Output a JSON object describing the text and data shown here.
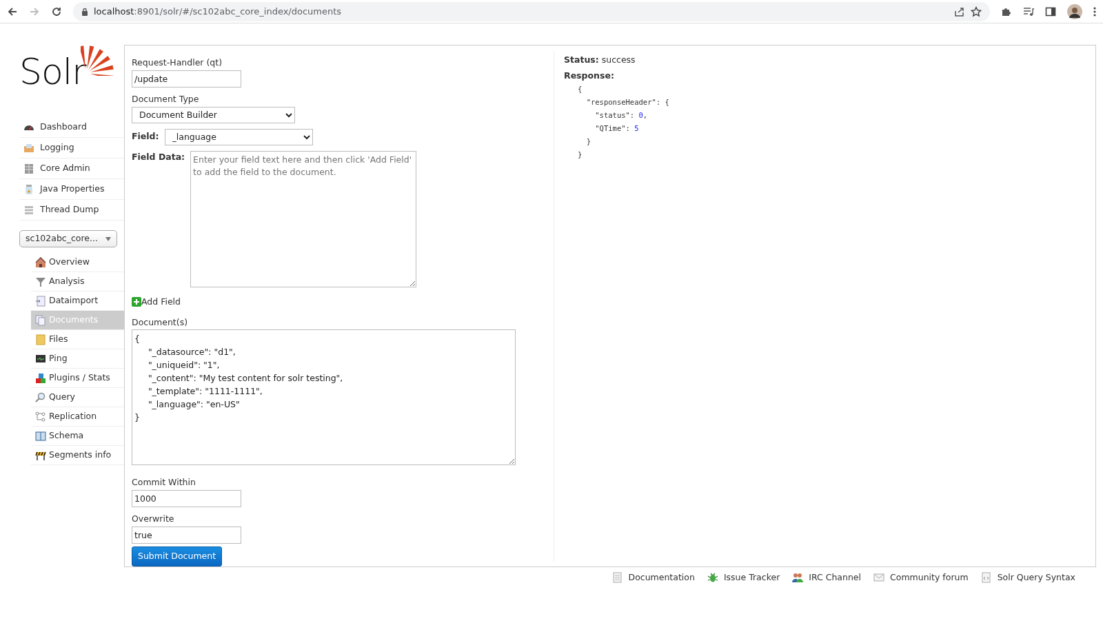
{
  "browser": {
    "url_host": "localhost",
    "url_rest": ":8901/solr/#/sc102abc_core_index/documents",
    "forward_disabled": true
  },
  "logo": {
    "text": "Solr"
  },
  "main_nav": [
    {
      "label": "Dashboard"
    },
    {
      "label": "Logging"
    },
    {
      "label": "Core Admin"
    },
    {
      "label": "Java Properties"
    },
    {
      "label": "Thread Dump"
    }
  ],
  "core_selector": {
    "value": "sc102abc_core..."
  },
  "core_nav": [
    {
      "label": "Overview",
      "selected": false
    },
    {
      "label": "Analysis",
      "selected": false
    },
    {
      "label": "Dataimport",
      "selected": false
    },
    {
      "label": "Documents",
      "selected": true
    },
    {
      "label": "Files",
      "selected": false
    },
    {
      "label": "Ping",
      "selected": false
    },
    {
      "label": "Plugins / Stats",
      "selected": false
    },
    {
      "label": "Query",
      "selected": false
    },
    {
      "label": "Replication",
      "selected": false
    },
    {
      "label": "Schema",
      "selected": false
    },
    {
      "label": "Segments info",
      "selected": false
    }
  ],
  "form": {
    "request_handler": {
      "label": "Request-Handler (qt)",
      "value": "/update"
    },
    "document_type": {
      "label": "Document Type",
      "value": "Document Builder"
    },
    "field": {
      "label": "Field:",
      "value": "_language"
    },
    "field_data": {
      "label": "Field Data:",
      "placeholder": "Enter your field text here and then click 'Add Field' to add the field to the document."
    },
    "add_field": "Add Field",
    "documents": {
      "label": "Document(s)",
      "value": "{\n\t\"_datasource\": \"d1\",\n\t\"_uniqueid\": \"1\",\n\t\"_content\": \"My test content for solr testing\",\n\t\"_template\": \"1111-1111\",\n\t\"_language\": \"en-US\"\n}"
    },
    "commit_within": {
      "label": "Commit Within",
      "value": "1000"
    },
    "overwrite": {
      "label": "Overwrite",
      "value": "true"
    },
    "submit": "Submit Document"
  },
  "response": {
    "status_label": "Status:",
    "status": "success",
    "response_label": "Response:",
    "lines": [
      "{",
      "  \"responseHeader\": {",
      "    \"status\": 0,",
      "    \"QTime\": 5",
      "  }",
      "}"
    ]
  },
  "footer_links": [
    {
      "label": "Documentation"
    },
    {
      "label": "Issue Tracker"
    },
    {
      "label": "IRC Channel"
    },
    {
      "label": "Community forum"
    },
    {
      "label": "Solr Query Syntax"
    }
  ]
}
